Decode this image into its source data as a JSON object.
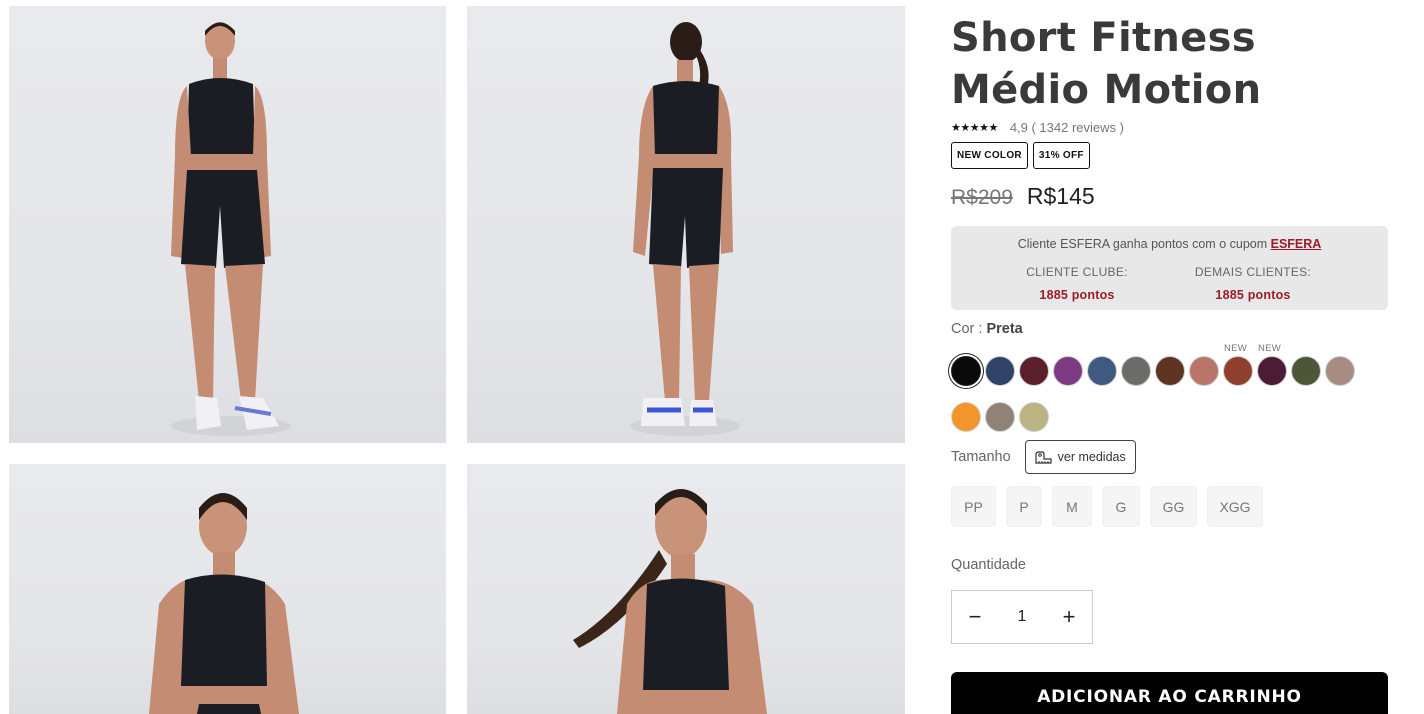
{
  "gallery": {
    "images": [
      {
        "alt": "Modelo frente corpo inteiro"
      },
      {
        "alt": "Modelo costas corpo inteiro"
      },
      {
        "alt": "Modelo frente meio corpo"
      },
      {
        "alt": "Modelo cabelo em movimento"
      }
    ]
  },
  "product": {
    "title": "Short Fitness Médio Motion",
    "stars": "★★★★★",
    "rating_text": "4,9 ( 1342 reviews )",
    "badges": [
      "NEW COLOR",
      "31% OFF"
    ],
    "old_price": "R$209",
    "price": "R$145"
  },
  "esfera": {
    "text": "Cliente ESFERA ganha pontos com o cupom ",
    "code": "ESFERA",
    "club_label": "CLIENTE CLUBE:",
    "club_points": "1885 pontos",
    "other_label": "DEMAIS CLIENTES:",
    "other_points": "1885 pontos"
  },
  "color": {
    "label": "Cor : ",
    "selected": "Preta",
    "new_tag": "NEW",
    "swatches": [
      {
        "name": "preta",
        "hex": "#0a0a0a"
      },
      {
        "name": "azul-marinho",
        "hex": "#2f4468"
      },
      {
        "name": "vinho",
        "hex": "#5c1f2e"
      },
      {
        "name": "roxo",
        "hex": "#7b3a82"
      },
      {
        "name": "azul",
        "hex": "#3e5a80"
      },
      {
        "name": "cinza-verde",
        "hex": "#6b6e68"
      },
      {
        "name": "marrom",
        "hex": "#5e3424"
      },
      {
        "name": "rose",
        "hex": "#b87568"
      },
      {
        "name": "telha",
        "hex": "#8f3f2c"
      },
      {
        "name": "berinjela",
        "hex": "#4b1c33"
      },
      {
        "name": "musgo",
        "hex": "#4e5638"
      },
      {
        "name": "nude",
        "hex": "#a78c81"
      },
      {
        "name": "laranja",
        "hex": "#f2952b"
      },
      {
        "name": "taupe",
        "hex": "#8e8374"
      },
      {
        "name": "oliva-claro",
        "hex": "#b9b482"
      }
    ]
  },
  "size": {
    "label": "Tamanho",
    "measures": "ver medidas",
    "options": [
      "PP",
      "P",
      "M",
      "G",
      "GG",
      "XGG"
    ]
  },
  "quantity": {
    "label": "Quantidade",
    "value": "1",
    "minus": "−",
    "plus": "+"
  },
  "cart": {
    "button": "ADICIONAR AO CARRINHO"
  }
}
